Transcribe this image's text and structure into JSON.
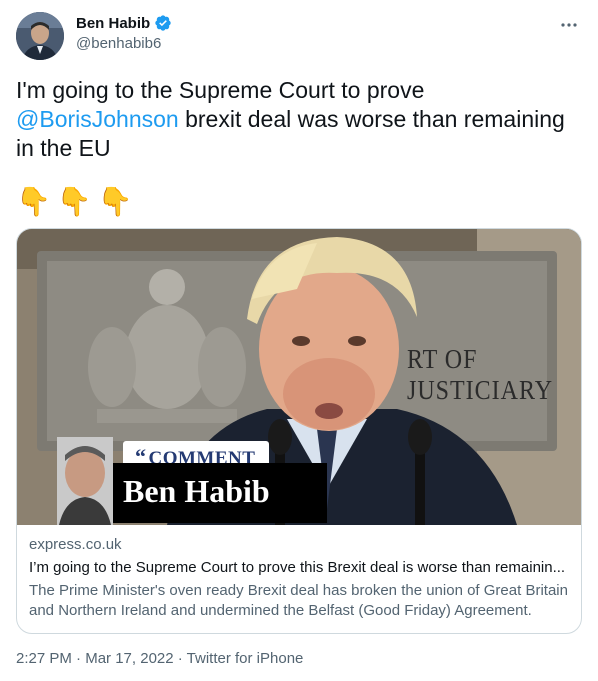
{
  "author": {
    "name": "Ben Habib",
    "handle": "@benhabib6",
    "verified": true
  },
  "tweet": {
    "text_before": "I'm going to the Supreme Court to prove ",
    "mention": "@BorisJohnson",
    "text_after": " brexit deal was worse than remaining in the EU",
    "emojis": [
      "👇",
      "👇",
      "👇"
    ]
  },
  "card": {
    "image": {
      "sign_text": "RT OF JUSTICIARY",
      "badge": "COMMENT",
      "byline": "Ben Habib"
    },
    "domain": "express.co.uk",
    "title": "I’m going to the Supreme Court to prove this Brexit deal is worse than remainin...",
    "description": "The Prime Minister's oven ready Brexit deal has broken the union of Great Britain and Northern Ireland and undermined the Belfast (Good Friday) Agreement."
  },
  "meta": {
    "time": "2:27 PM",
    "date": "Mar 17, 2022",
    "source": "Twitter for iPhone",
    "separator": " · "
  },
  "colors": {
    "accent": "#1d9bf0",
    "text": "#0f1419",
    "muted": "#536471",
    "border": "#cfd9de"
  },
  "icons": [
    "verified-badge-icon",
    "more-options-icon",
    "pointing-down-emoji"
  ]
}
